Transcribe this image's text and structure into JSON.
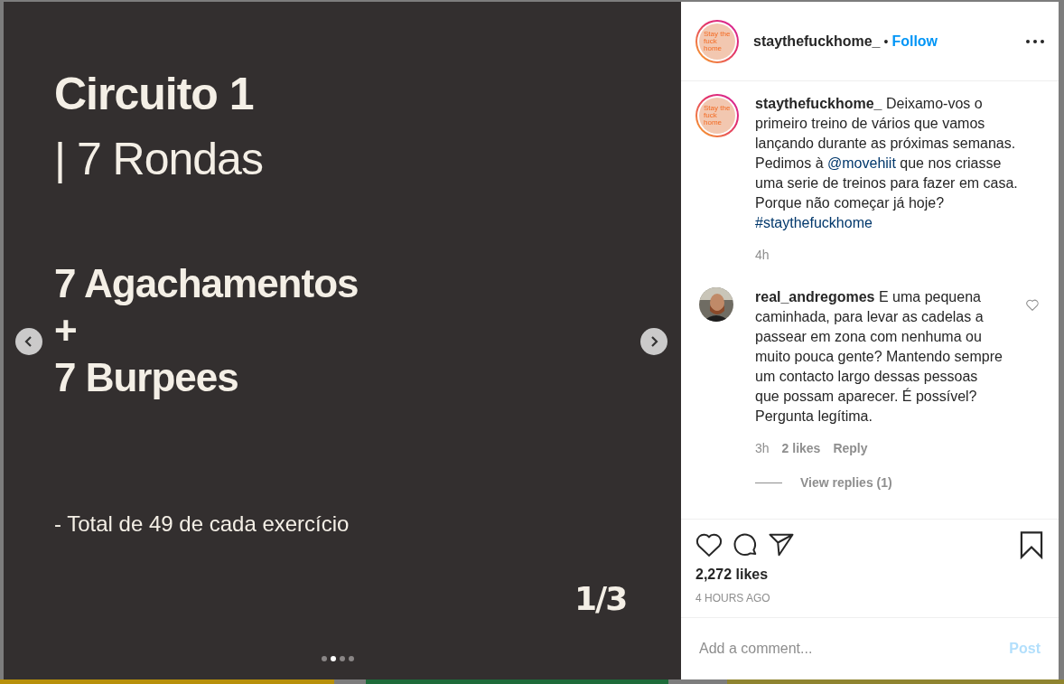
{
  "slide": {
    "lines": [
      {
        "kind": "title",
        "text": "Circuito 1"
      },
      {
        "kind": "subtitle",
        "text": "| 7 Rondas"
      },
      {
        "kind": "exercise",
        "text": "7 Agachamentos"
      },
      {
        "kind": "plus",
        "text": "+"
      },
      {
        "kind": "exercise",
        "text": "7 Burpees"
      },
      {
        "kind": "note",
        "text": "- Total de 49 de cada exercício"
      }
    ],
    "counter": "1/3",
    "dots": [
      {
        "selected": false
      },
      {
        "selected": true
      },
      {
        "selected": false
      },
      {
        "selected": false
      }
    ]
  },
  "header": {
    "avatar_text": "Stay the fuck home",
    "username": "staythefuckhome_",
    "separator": "•",
    "follow": "Follow"
  },
  "caption": {
    "avatar_text": "Stay the fuck home",
    "username": "staythefuckhome_",
    "parts": [
      {
        "kind": "text",
        "text": "Deixamo-vos o primeiro treino de vários que vamos lançando durante as próximas semanas. Pedimos à "
      },
      {
        "kind": "link",
        "text": "@movehiit"
      },
      {
        "kind": "text",
        "text": " que nos criasse uma serie de treinos para fazer em casa. Porque não começar já hoje? "
      },
      {
        "kind": "link",
        "text": "#staythefuckhome"
      }
    ],
    "time": "4h"
  },
  "comments": [
    {
      "username": "real_andregomes",
      "text": "E uma pequena caminhada, para levar as cadelas a passear em zona com nenhuma ou muito pouca gente? Mantendo sempre um contacto largo dessas pessoas que possam aparecer. É possível? Pergunta legítima.",
      "time": "3h",
      "likes": "2 likes",
      "reply": "Reply",
      "view_replies": "View replies (1)",
      "liked": false
    }
  ],
  "likes": "2,272 likes",
  "posted": "4 HOURS AGO",
  "comment_field": {
    "placeholder": "Add a comment..."
  },
  "post_button": {
    "label": "Post",
    "disabled": true
  }
}
